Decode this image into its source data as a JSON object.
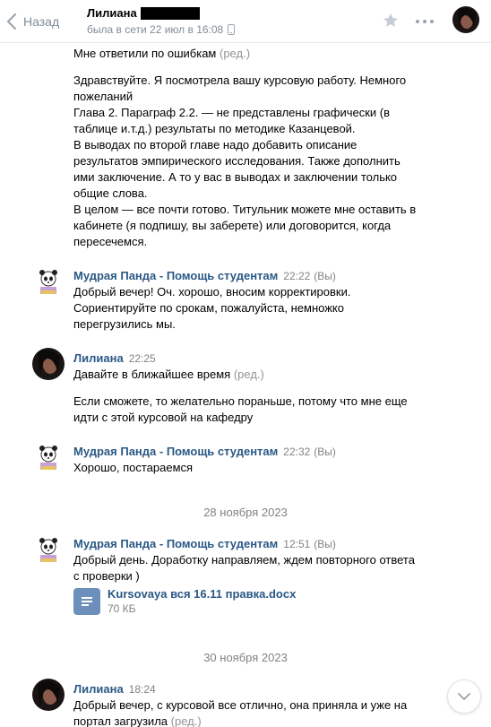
{
  "header": {
    "back_label": "Назад",
    "peer_name": "Лилиана",
    "peer_status": "была в сети 22 июл в 16:08",
    "icons": {
      "back": "chevron-left-icon",
      "phone": "phone-icon",
      "star": "star-icon",
      "more": "more-icon"
    }
  },
  "messages": [
    {
      "text": "Мне ответили по ошибкам",
      "edited": "(ред.)"
    },
    {
      "lines": [
        "Здравствуйте. Я посмотрела вашу курсовую работу. Немного пожеланий",
        "Глава 2. Параграф 2.2. — не представлены графически (в таблице и.т.д.) результаты по методике Казанцевой.",
        "В выводах по второй главе надо добавить описание результатов эмпирического исследования. Также дополнить ими заключение. А то у вас в выводах и заключении только общие слова.",
        "В целом — все почти готово. Титульник можете мне оставить в кабинете (я подпишу, вы заберете) или договорится, когда пересечемся."
      ]
    },
    {
      "author": "Мудрая Панда - Помощь студентам",
      "time": "22:22",
      "you": "(Вы)",
      "text": "Добрый вечер! Оч. хорошо, вносим корректировки. Сориентируйте по срокам, пожалуйста, немножко перегрузились мы."
    },
    {
      "author": "Лилиана",
      "time": "22:25",
      "text": "Давайте в ближайшее время",
      "edited": "(ред.)",
      "text2": "Если сможете, то желательно пораньше, потому что мне еще идти с этой курсовой на кафедру"
    },
    {
      "author": "Мудрая Панда - Помощь студентам",
      "time": "22:32",
      "you": "(Вы)",
      "text": "Хорошо, постараемся"
    },
    {
      "date": "28 ноября 2023"
    },
    {
      "author": "Мудрая Панда - Помощь студентам",
      "time": "12:51",
      "you": "(Вы)",
      "text": "Добрый день. Доработку направляем, ждем повторного ответа с проверки )",
      "attachment": {
        "name": "Kursovaya вся 16.11 правка.docx",
        "size": "70 КБ",
        "icon": "document-icon"
      }
    },
    {
      "date": "30 ноября 2023"
    },
    {
      "author": "Лилиана",
      "time": "18:24",
      "text": "Добрый вечер, с курсовой все отлично, она приняла и уже на портал загрузила",
      "edited": "(ред.)"
    }
  ],
  "colors": {
    "link": "#2a5885",
    "meta": "#828282",
    "doc": "#6d8fbb",
    "icon": "#99a2ad"
  }
}
